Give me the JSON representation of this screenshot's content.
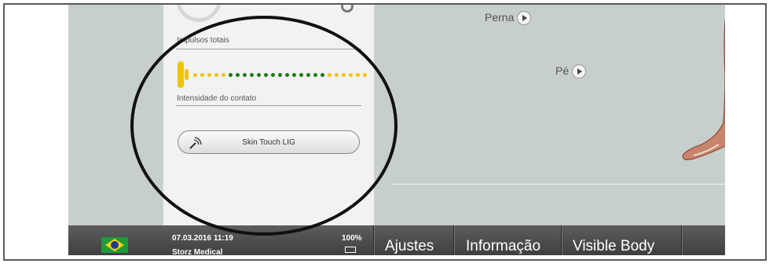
{
  "panel": {
    "pulses_label": "Impulsos totais",
    "intensity_label": "Intensidade do contato",
    "skin_button": "Skin Touch LIG"
  },
  "intensity": {
    "colors": [
      "#f2c400",
      "#f2c400",
      "#f2c400",
      "#f2c400",
      "#f2c400",
      "#1a7a1a",
      "#1a7a1a",
      "#1a7a1a",
      "#1a7a1a",
      "#1a7a1a",
      "#1a7a1a",
      "#1a7a1a",
      "#1a7a1a",
      "#1a7a1a",
      "#1a7a1a",
      "#1a7a1a",
      "#1a7a1a",
      "#1a7a1a",
      "#1a7a1a",
      "#f2c400",
      "#f2c400",
      "#f2c400",
      "#f2c400",
      "#f2c400",
      "#f2c400"
    ]
  },
  "body_nav": {
    "leg": "Perna",
    "foot": "Pé"
  },
  "status": {
    "datetime": "07.03.2016 11:19",
    "org": "Storz Medical",
    "battery": "100%"
  },
  "tabs": {
    "settings": "Ajustes",
    "info": "Informação",
    "visible_body": "Visible Body"
  }
}
